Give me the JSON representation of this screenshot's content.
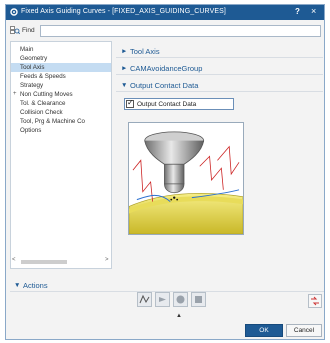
{
  "window": {
    "title": "Fixed Axis Guiding Curves - [FIXED_AXIS_GUIDING_CURVES]",
    "help_glyph": "?",
    "close_glyph": "×"
  },
  "find": {
    "label": "Find",
    "value": "",
    "placeholder": ""
  },
  "tree": {
    "items": [
      {
        "label": "Main",
        "selected": false,
        "twisty": ""
      },
      {
        "label": "Geometry",
        "selected": false,
        "twisty": ""
      },
      {
        "label": "Tool Axis",
        "selected": true,
        "twisty": ""
      },
      {
        "label": "Feeds & Speeds",
        "selected": false,
        "twisty": ""
      },
      {
        "label": "Strategy",
        "selected": false,
        "twisty": ""
      },
      {
        "label": "Non Cutting Moves",
        "selected": false,
        "twisty": "+"
      },
      {
        "label": "Tol. & Clearance",
        "selected": false,
        "twisty": ""
      },
      {
        "label": "Collision Check",
        "selected": false,
        "twisty": ""
      },
      {
        "label": "Tool, Prg & Machine Co",
        "selected": false,
        "twisty": ""
      },
      {
        "label": "Options",
        "selected": false,
        "twisty": ""
      }
    ],
    "scroll_left": "<",
    "scroll_right": ">"
  },
  "panel": {
    "sections": [
      {
        "label": "Tool Axis",
        "chevron": "►"
      },
      {
        "label": "CAMAvoidanceGroup",
        "chevron": "►"
      },
      {
        "label": "Output Contact Data",
        "chevron": "▼"
      }
    ],
    "checkbox": {
      "label": "Output Contact Data",
      "checked": true
    }
  },
  "actions": {
    "label": "Actions",
    "chevron": "▼",
    "icons": [
      "generate-icon",
      "replay-icon",
      "list-icon",
      "verify-icon"
    ]
  },
  "expand_glyph": "▲",
  "buttons": {
    "ok": "OK",
    "cancel": "Cancel"
  },
  "colors": {
    "title_bar": "#1e5a94",
    "selection": "#c4dcf2",
    "section_text": "#1e5a94",
    "ok_button": "#1e5a94"
  }
}
